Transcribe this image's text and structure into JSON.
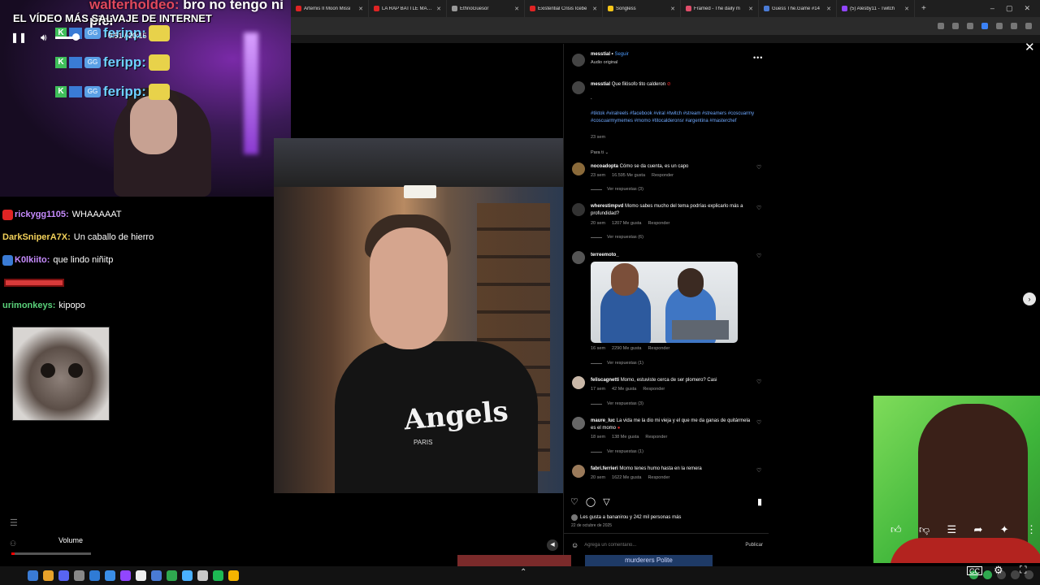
{
  "browser": {
    "tabs": [
      {
        "label": "Artemis II Moon Missi",
        "color": "#e02424"
      },
      {
        "label": "LA RAP BATTLE MÁS C",
        "color": "#e02424"
      },
      {
        "label": "EthnoGuesor",
        "color": "#999999"
      },
      {
        "label": "Existential Crisis Icebe",
        "color": "#e02424"
      },
      {
        "label": "Songless",
        "color": "#f5c518"
      },
      {
        "label": "Framed - The daily m",
        "color": "#e04d6a"
      },
      {
        "label": "Guess The.Game #14",
        "color": "#4a7bd5"
      },
      {
        "label": "(5) Alesby11 - Twitch",
        "color": "#9146ff"
      }
    ],
    "new_tab": "+",
    "win_minimize": "–",
    "win_maximize": "▢",
    "win_close": "✕"
  },
  "webcam": {
    "top_username": "walterholdeo:",
    "top_message": "bro no tengo ni pici",
    "title": "EL VÍDEO MÁS SALVAJE DE INTERNET",
    "emote_user": "feripp:",
    "emote_k": "K",
    "emote_g": "GG"
  },
  "chat": [
    {
      "user": "rickygg1105:",
      "message": "WHAAAAAT",
      "color": "#c78cff",
      "badge": "#e02424"
    },
    {
      "user": "DarkSniperA7X:",
      "message": "Un caballo de hierro",
      "color": "#f2d15a",
      "badge": ""
    },
    {
      "user": "K0lkiito:",
      "message": "que lindo niñitp",
      "color": "#c78cff",
      "badge": "#3a7bd5"
    },
    {
      "user": "urimonkeys:",
      "message": "kipopo",
      "color": "#5ad17a",
      "badge": ""
    }
  ],
  "post": {
    "author": "messtial",
    "follow": "Seguir",
    "audio": "Audio original",
    "caption_author": "messtial",
    "caption": "Que filósofo tito calderon",
    "caption_dot": ".",
    "hashtags": "#tiktok #viralreels #facebook #viral #twitch #stream #streamers #coscuarmy #coscuarmymemes #momo #titocalderonsr #argentina #masterchef",
    "caption_age": "23 sem",
    "sort_label": "Para ti",
    "likes_text": "Les gusta a bananirou y 242 mil personas más",
    "date": "22 de octubre de 2025",
    "comment_placeholder": "Agrega un comentario...",
    "publish": "Publicar"
  },
  "comments": [
    {
      "user": "nocoadopta",
      "text": "Cómo se da cuenta, es un capo",
      "age": "23 sem",
      "likes": "16.595 Me gusta",
      "reply": "Responder",
      "replies": "Ver respuestas (3)"
    },
    {
      "user": "wherestimpvd",
      "text": "Momo sabes mucho del tema podrías explicarlo más a profundidad?",
      "age": "20 sem",
      "likes": "1207 Me gusta",
      "reply": "Responder",
      "replies": "Ver respuestas (6)"
    },
    {
      "user": "terreemoto_",
      "text": "",
      "age": "16 sem",
      "likes": "2290 Me gusta",
      "reply": "Responder",
      "replies": "Ver respuestas (1)"
    },
    {
      "user": "feliscagnetti",
      "text": "Momo, estuviste cerca de ser plomero? Casi",
      "age": "17 sem",
      "likes": "42 Me gusta",
      "reply": "Responder",
      "replies": "Ver respuestas (3)"
    },
    {
      "user": "maure_luc",
      "text": "La vida me la dio mi vieja y el que me da ganas de quitármela es el momo",
      "age": "18 sem",
      "likes": "138 Me gusta",
      "reply": "Responder",
      "replies": "Ver respuestas (1)"
    },
    {
      "user": "fabri.ferrieri",
      "text": "Momo tenes humo hasta en la remera",
      "age": "20 sem",
      "likes": "1622 Me gusta",
      "reply": "Responder",
      "replies": ""
    }
  ],
  "video": {
    "shirt_text": "Angels",
    "shirt_sub": "PARIS"
  },
  "player": {
    "volume_label": "Volume",
    "time": "0:51 / 20:15",
    "progress": 0.042
  },
  "bottom_banner": "murderers  Polite"
}
